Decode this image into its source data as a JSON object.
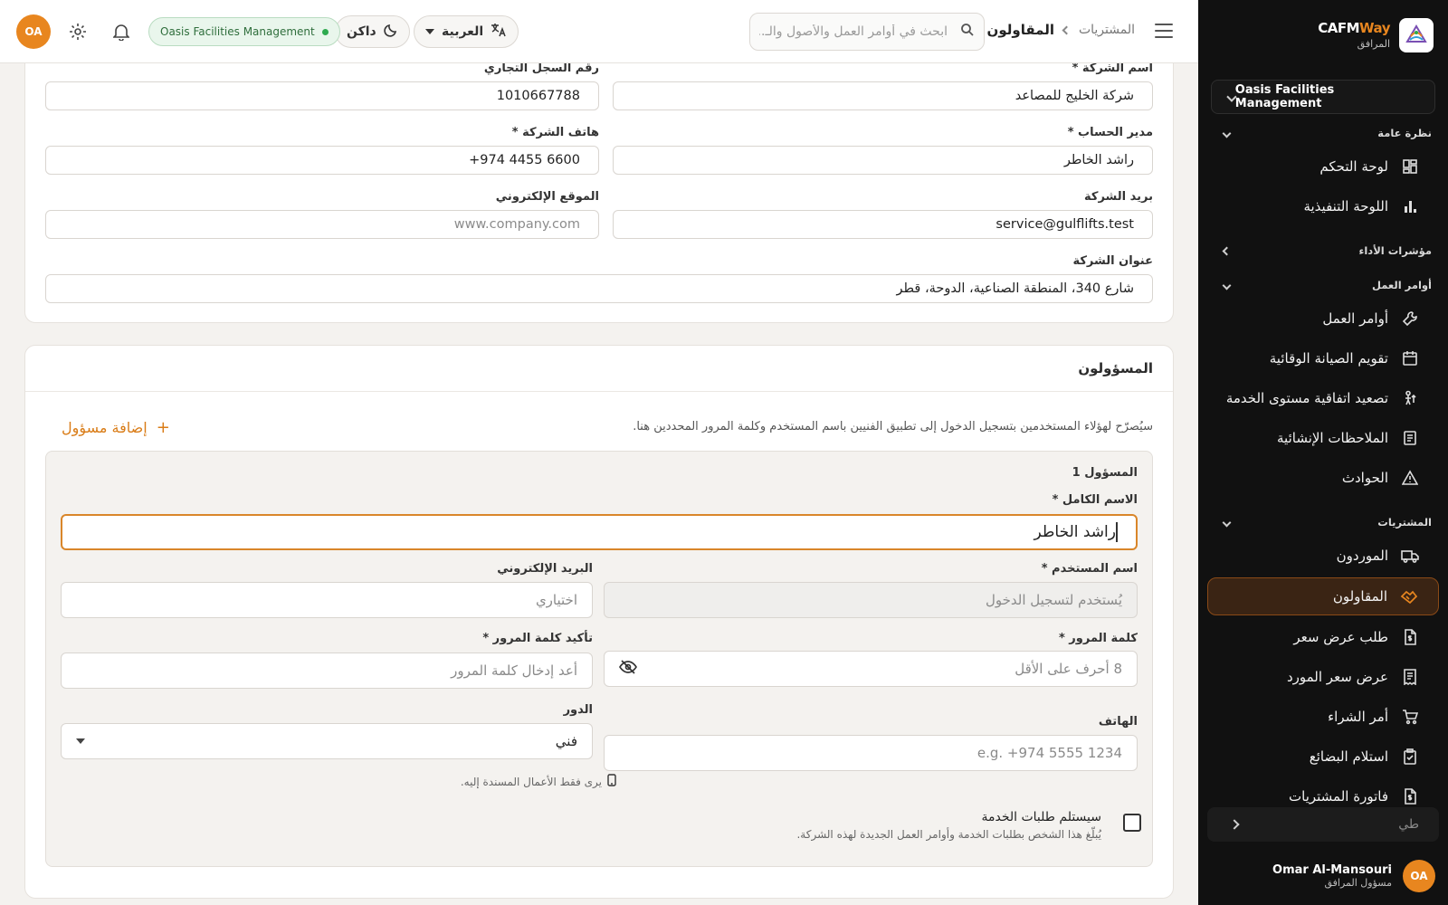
{
  "brand": {
    "name_main": "CAFM",
    "name_accent": "Way",
    "subtitle": "المرافق",
    "accent_color": "#e8861f"
  },
  "sidebar": {
    "org_selector": "Oasis Facilities Management",
    "sections": {
      "overview": "نظرة عامة",
      "kpis": "مؤشرات الأداء",
      "work_orders": "أوامر العمل",
      "procurement": "المشتريات"
    },
    "items": {
      "dashboard": "لوحة التحكم",
      "executive": "اللوحة التنفيذية",
      "work_orders": "أوامر العمل",
      "pm_calendar": "تقويم الصيانة الوقائية",
      "sla_escalation": "تصعيد اتفاقية مستوى الخدمة",
      "snags": "الملاحظات الإنشائية",
      "incidents": "الحوادث",
      "suppliers": "الموردون",
      "contractors": "المقاولون",
      "rfq": "طلب عرض سعر",
      "supplier_quote": "عرض سعر المورد",
      "purchase_order": "أمر الشراء",
      "goods_receipt": "استلام البضائع",
      "procurement_invoice": "فاتورة المشتريات"
    },
    "collapse_label": "طي",
    "user": {
      "initials": "OA",
      "name": "Omar Al-Mansouri",
      "role": "مسؤول المرافق"
    }
  },
  "topbar": {
    "breadcrumb_parent": "المشتريات",
    "breadcrumb_current": "المقاولون",
    "search_placeholder": "ابحث في أوامر العمل والأصول والـ...",
    "language": "العربية",
    "theme": "داكن",
    "org_badge": "Oasis Facilities Management",
    "avatar_initials": "OA"
  },
  "company": {
    "name_label": "اسم الشركة *",
    "name_value": "شركة الخليج للمصاعد",
    "cr_label": "رقم السجل التجاري",
    "cr_value": "1010667788",
    "manager_label": "مدير الحساب *",
    "manager_value": "راشد الخاطر",
    "phone_label": "هاتف الشركة *",
    "phone_value": "+974 4455 6600",
    "email_label": "بريد الشركة",
    "email_value": "service@gulflifts.test",
    "website_label": "الموقع الإلكتروني",
    "website_placeholder": "www.company.com",
    "address_label": "عنوان الشركة",
    "address_value": "شارع 340، المنطقة الصناعية، الدوحة، قطر"
  },
  "responsibles": {
    "title": "المسؤولون",
    "hint": "سيُصرّح لهؤلاء المستخدمين بتسجيل الدخول إلى تطبيق الفنيين باسم المستخدم وكلمة المرور المحددين هنا.",
    "add_button": "إضافة مسؤول",
    "entry": {
      "heading": "المسؤول 1",
      "fullname_label": "الاسم الكامل *",
      "fullname_value": "راشد الخاطر",
      "username_label": "اسم المستخدم *",
      "username_placeholder": "يُستخدم لتسجيل الدخول",
      "email_label": "البريد الإلكتروني",
      "email_placeholder": "اختياري",
      "password_label": "كلمة المرور *",
      "password_placeholder": "8 أحرف على الأقل",
      "confirm_label": "تأكيد كلمة المرور *",
      "confirm_placeholder": "أعد إدخال كلمة المرور",
      "phone_label": "الهاتف",
      "phone_placeholder": "e.g. +974 5555 1234",
      "role_label": "الدور",
      "role_value": "فني",
      "role_note": "يرى فقط الأعمال المسندة إليه.",
      "notify_title": "سيستلم طلبات الخدمة",
      "notify_sub": "يُبلّغ هذا الشخص بطلبات الخدمة وأوامر العمل الجديدة لهذه الشركة.",
      "notify_checked": false
    }
  }
}
